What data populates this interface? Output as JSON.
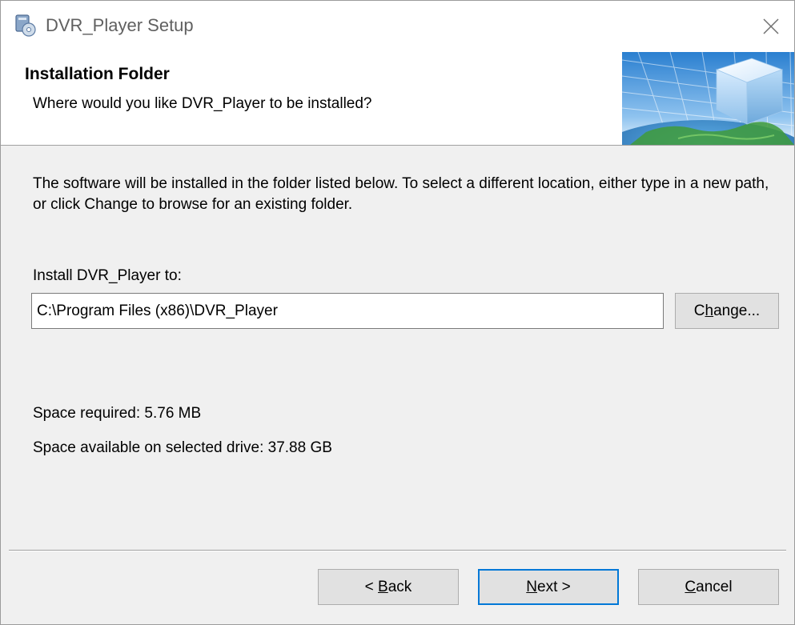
{
  "window": {
    "title": "DVR_Player Setup"
  },
  "header": {
    "title": "Installation Folder",
    "subtitle": "Where would you like DVR_Player to be installed?"
  },
  "body": {
    "description": "The software will be installed in the folder listed below. To select a different location, either type in a new path, or click Change to browse for an existing folder.",
    "install_label": "Install DVR_Player to:",
    "install_path": "C:\\Program Files (x86)\\DVR_Player",
    "change_button": {
      "before": "C",
      "accel": "h",
      "after": "ange..."
    },
    "space_required": "Space required: 5.76 MB",
    "space_available": "Space available on selected drive: 37.88 GB"
  },
  "footer": {
    "back_button": {
      "before": "< ",
      "accel": "B",
      "after": "ack"
    },
    "next_button": {
      "before": "",
      "accel": "N",
      "after": "ext >"
    },
    "cancel_button": {
      "before": "",
      "accel": "C",
      "after": "ancel"
    }
  },
  "colors": {
    "focus_border": "#0078d7",
    "button_face": "#e1e1e1",
    "dialog_background": "#f0f0f0"
  }
}
